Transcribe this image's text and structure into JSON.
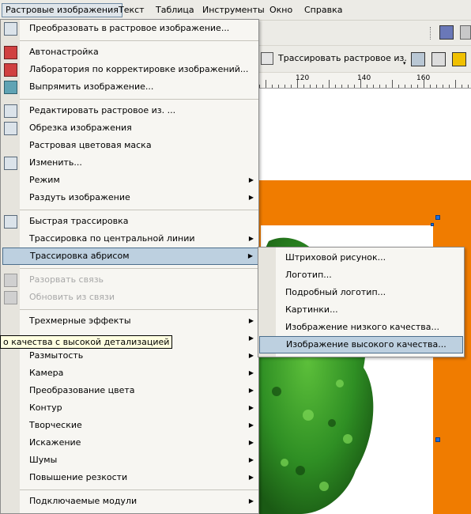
{
  "menubar": {
    "items": [
      "Растровые изображения",
      "Текст",
      "Таблица",
      "Инструменты",
      "Окно",
      "Справка"
    ],
    "active_index": 0
  },
  "toolbar": {
    "trace_label": "Трассировать растровое из."
  },
  "ruler": {
    "labels": [
      "120",
      "140",
      "160"
    ]
  },
  "menu": {
    "items": [
      {
        "label": "Преобразовать в растровое изображение...",
        "icon": "convert-bitmap-icon"
      },
      {
        "label": "Автонастройка",
        "icon": "auto-adjust-icon"
      },
      {
        "label": "Лаборатория по корректировке изображений...",
        "icon": "image-lab-icon"
      },
      {
        "label": "Выпрямить изображение...",
        "icon": "straighten-icon"
      },
      {
        "label": "Редактировать растровое из. ...",
        "icon": "edit-bitmap-icon"
      },
      {
        "label": "Обрезка изображения",
        "icon": "crop-icon"
      },
      {
        "label": "Растровая цветовая маска",
        "icon": ""
      },
      {
        "label": "Изменить...",
        "icon": "resample-icon"
      },
      {
        "label": "Режим",
        "submenu": true
      },
      {
        "label": "Раздуть изображение",
        "submenu": true
      },
      {
        "label": "Быстрая трассировка",
        "icon": "quick-trace-icon"
      },
      {
        "label": "Трассировка по центральной линии",
        "submenu": true
      },
      {
        "label": "Трассировка абрисом",
        "submenu": true,
        "highlighted": true
      },
      {
        "label": "Разорвать связь",
        "disabled": true,
        "icon": "break-link-icon"
      },
      {
        "label": "Обновить из связи",
        "disabled": true,
        "icon": "update-link-icon"
      },
      {
        "label": "Трехмерные эффекты",
        "submenu": true
      },
      {
        "label": "",
        "submenu": true
      },
      {
        "label": "Размытость",
        "submenu": true
      },
      {
        "label": "Камера",
        "submenu": true
      },
      {
        "label": "Преобразование цвета",
        "submenu": true
      },
      {
        "label": "Контур",
        "submenu": true
      },
      {
        "label": "Творческие",
        "submenu": true
      },
      {
        "label": "Искажение",
        "submenu": true
      },
      {
        "label": "Шумы",
        "submenu": true
      },
      {
        "label": "Повышение резкости",
        "submenu": true
      },
      {
        "label": "Подключаемые модули",
        "submenu": true
      }
    ]
  },
  "submenu": {
    "items": [
      {
        "label": "Штриховой рисунок..."
      },
      {
        "label": "Логотип..."
      },
      {
        "label": "Подробный логотип..."
      },
      {
        "label": "Картинки..."
      },
      {
        "label": "Изображение низкого качества..."
      },
      {
        "label": "Изображение высокого качества...",
        "highlighted": true
      }
    ]
  },
  "tooltip": {
    "text": "о качества с высокой детализацией"
  },
  "colors": {
    "orange": "#f07c00",
    "highlight": "#bdd0e0",
    "menu_bg": "#f7f6f2"
  }
}
